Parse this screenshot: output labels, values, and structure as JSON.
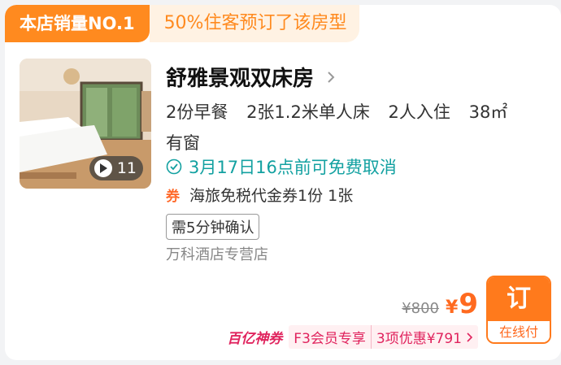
{
  "banner": {
    "rank": "本店销量NO.1",
    "note": "50%住客预订了该房型"
  },
  "room": {
    "title": "舒雅景观双床房",
    "specs": [
      "2份早餐",
      "2张1.2米单人床",
      "2人入住",
      "38㎡"
    ],
    "window": "有窗",
    "cancel": "3月17日16点前可免费取消",
    "coupon_icon": "券",
    "coupon": "海旅免税代金券1份 1张",
    "confirm": "需5分钟确认",
    "shop": "万科酒店专营店",
    "video_count": "11"
  },
  "price": {
    "original": "¥800",
    "currency": "¥",
    "current": "9"
  },
  "book": {
    "label": "订",
    "sub": "在线付"
  },
  "promo": {
    "brand": "百亿神券",
    "member": "F3会员专享",
    "deals": "3项优惠¥791"
  },
  "colors": {
    "accent": "#ff7a1c",
    "teal": "#13a1a1",
    "promo": "#e0245e"
  },
  "icons": {
    "play": "play-icon",
    "chevron": "chevron-right-icon",
    "check": "check-circle-icon"
  }
}
